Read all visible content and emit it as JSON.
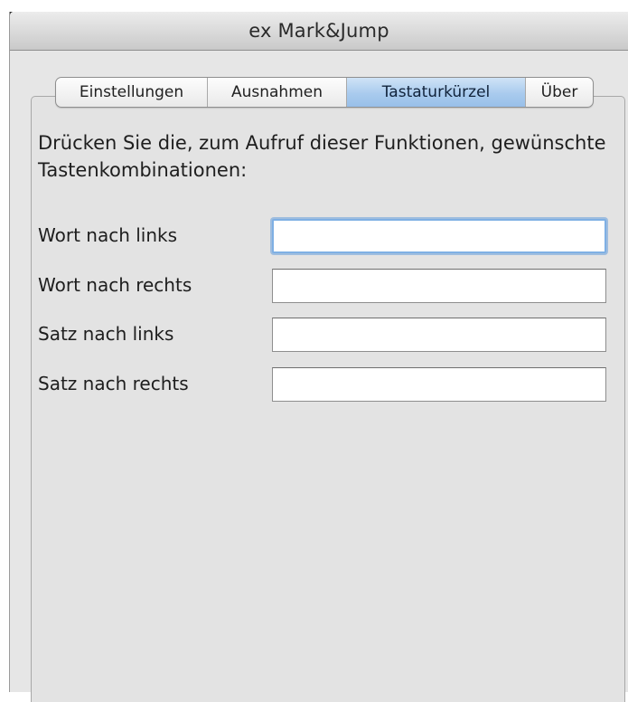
{
  "window": {
    "title": "ex Mark&Jump"
  },
  "tabs": [
    {
      "label": "Einstellungen",
      "selected": false
    },
    {
      "label": "Ausnahmen",
      "selected": false
    },
    {
      "label": "Tastaturkürzel",
      "selected": true
    },
    {
      "label": "Über",
      "selected": false
    }
  ],
  "instructions": "Drücken Sie die, zum Aufruf dieser Funktionen, gewünschte Tastenkombinationen:",
  "shortcuts": [
    {
      "label": "Wort nach links",
      "value": "",
      "focused": true
    },
    {
      "label": "Wort nach rechts",
      "value": "",
      "focused": false
    },
    {
      "label": "Satz nach links",
      "value": "",
      "focused": false
    },
    {
      "label": "Satz nach rechts",
      "value": "",
      "focused": false
    }
  ],
  "colors": {
    "selected_tab": "#a9cbee",
    "focus_ring": "#7fb0e4",
    "panel_background": "#e3e3e3"
  }
}
